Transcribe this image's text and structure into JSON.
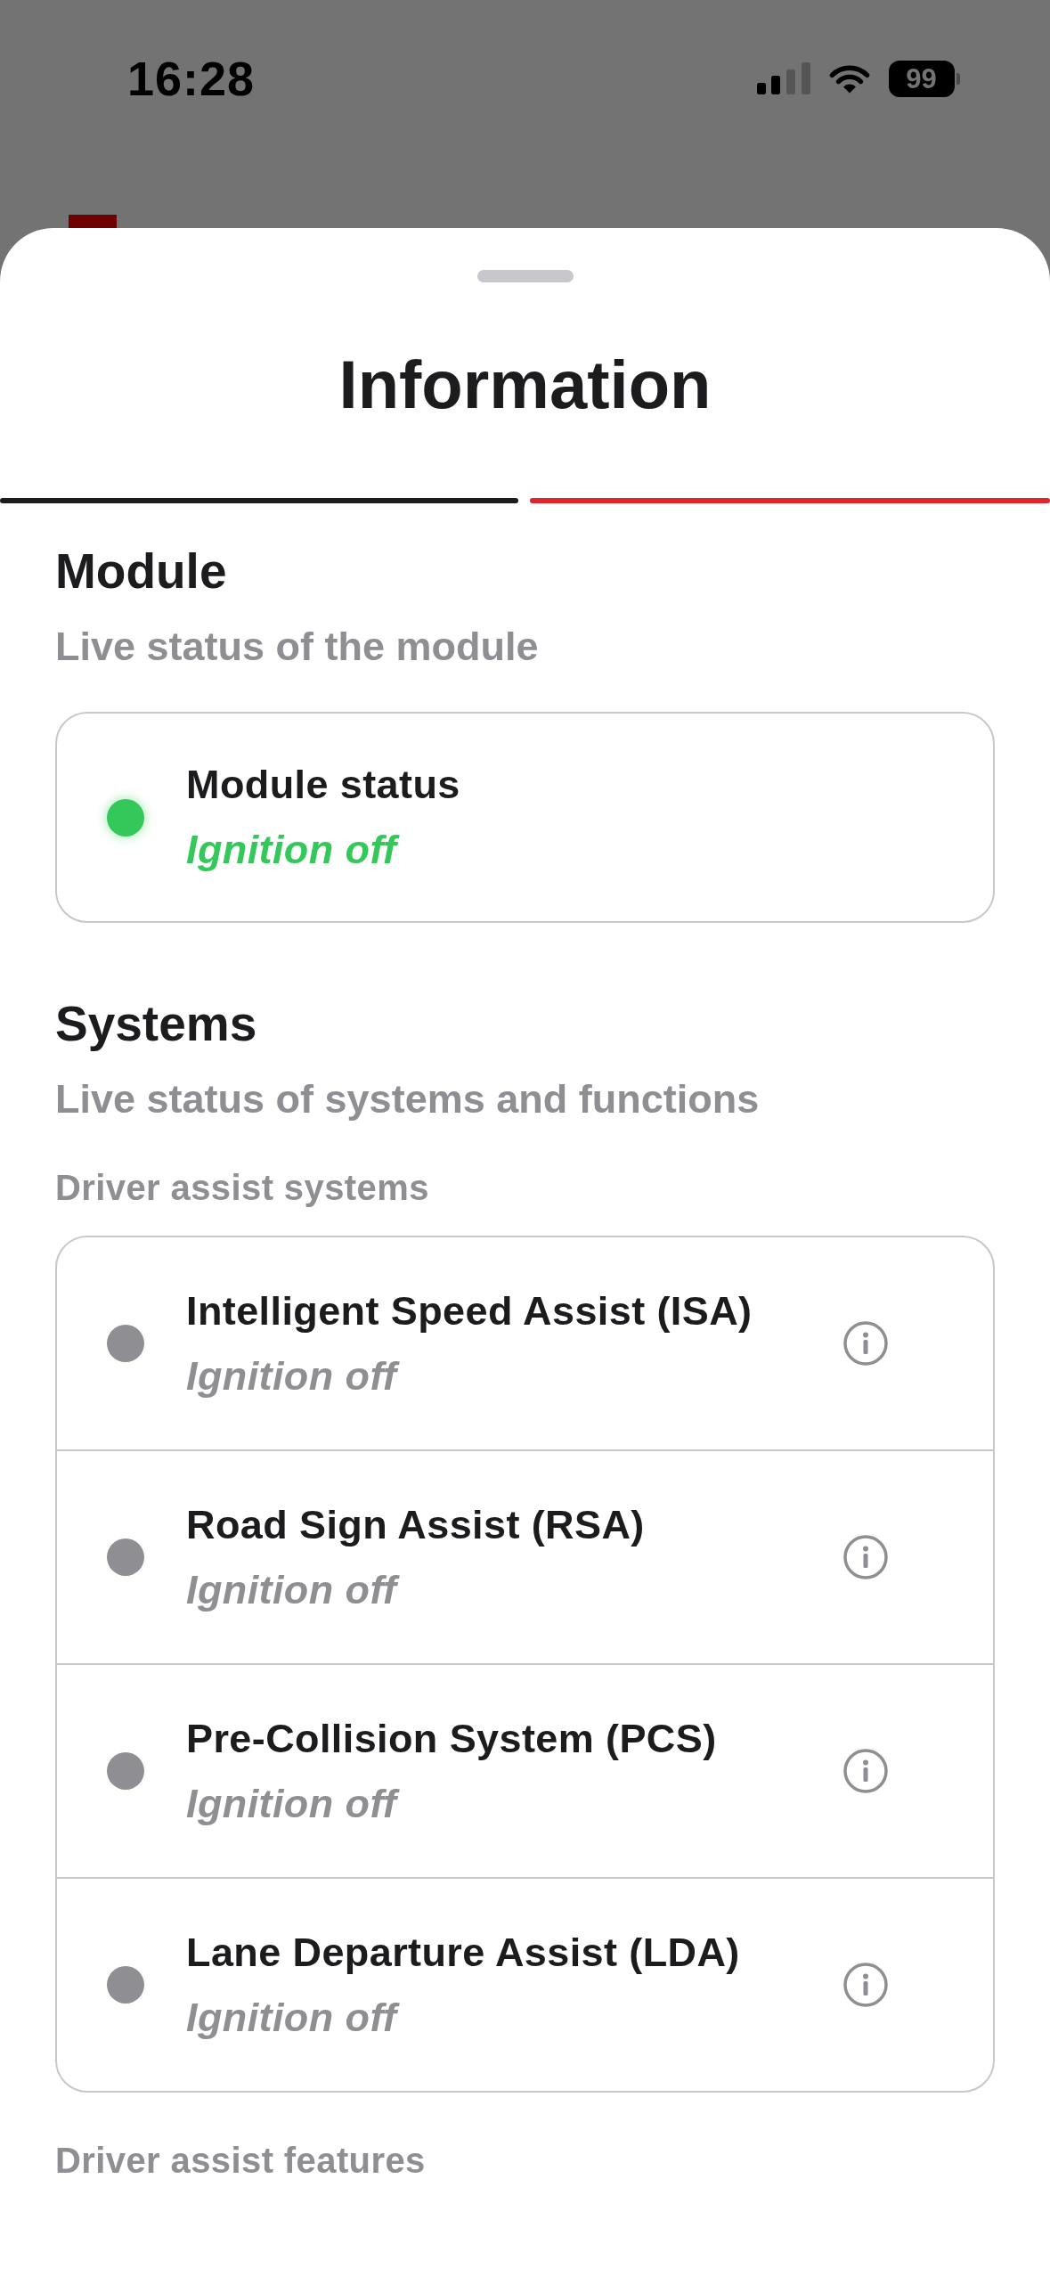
{
  "status_bar": {
    "time": "16:28",
    "battery": "99"
  },
  "sheet": {
    "title": "Information"
  },
  "module": {
    "title": "Module",
    "subtitle": "Live status of the module",
    "status": {
      "name": "Module status",
      "value": "Ignition off",
      "color": "#34c759"
    }
  },
  "systems": {
    "title": "Systems",
    "subtitle": "Live status of systems and functions",
    "groups": [
      {
        "label": "Driver assist systems",
        "items": [
          {
            "name": "Intelligent Speed Assist (ISA)",
            "value": "Ignition off",
            "color": "#8e8e93"
          },
          {
            "name": "Road Sign Assist (RSA)",
            "value": "Ignition off",
            "color": "#8e8e93"
          },
          {
            "name": "Pre-Collision System (PCS)",
            "value": "Ignition off",
            "color": "#8e8e93"
          },
          {
            "name": "Lane Departure Assist (LDA)",
            "value": "Ignition off",
            "color": "#8e8e93"
          }
        ]
      },
      {
        "label": "Driver assist features"
      }
    ]
  }
}
